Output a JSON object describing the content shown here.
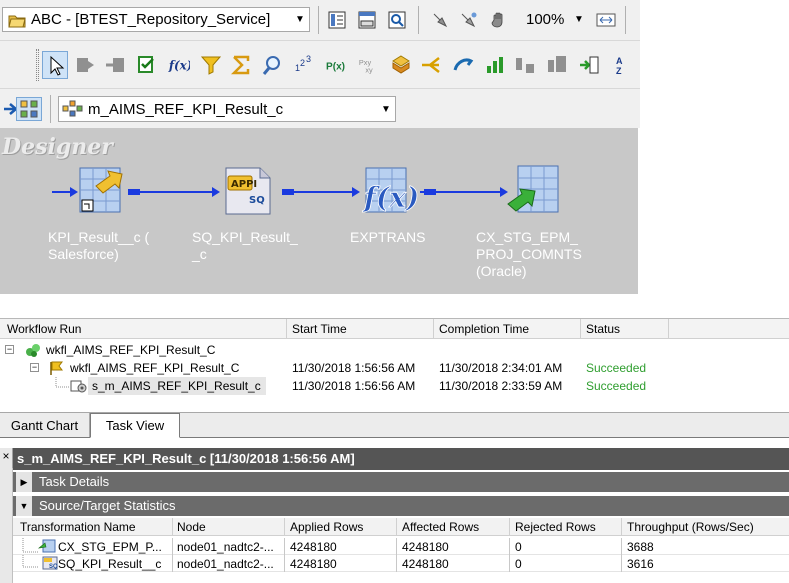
{
  "toolbar": {
    "repository": "ABC - [BTEST_Repository_Service]",
    "zoom": "100%",
    "mapping": "m_AIMS_REF_KPI_Result_c"
  },
  "designer": {
    "title": "Designer",
    "transformations": [
      {
        "label": "KPI_Result__c (\nSalesforce)"
      },
      {
        "label": "SQ_KPI_Result_\n_c"
      },
      {
        "label": "EXPTRANS"
      },
      {
        "label": "CX_STG_EPM_\nPROJ_COMNTS\n(Oracle)"
      }
    ]
  },
  "workflow_monitor": {
    "columns": [
      "Workflow Run",
      "Start Time",
      "Completion Time",
      "Status"
    ],
    "rows": [
      {
        "name": "wkfl_AIMS_REF_KPI_Result_C",
        "start": "",
        "completion": "",
        "status": ""
      },
      {
        "name": "wkfl_AIMS_REF_KPI_Result_C",
        "start": "11/30/2018 1:56:56 AM",
        "completion": "11/30/2018 2:34:01 AM",
        "status": "Succeeded"
      },
      {
        "name": "s_m_AIMS_REF_KPI_Result_c",
        "start": "11/30/2018 1:56:56 AM",
        "completion": "11/30/2018 2:33:59 AM",
        "status": "Succeeded"
      }
    ],
    "status_color": "#2f9e2f"
  },
  "tabs": [
    "Gantt Chart",
    "Task View"
  ],
  "session": {
    "close": "×",
    "title": "s_m_AIMS_REF_KPI_Result_c [11/30/2018 1:56:56 AM]",
    "sections": [
      "Task Details",
      "Source/Target Statistics"
    ],
    "stats_columns": [
      "Transformation Name",
      "Node",
      "Applied Rows",
      "Affected Rows",
      "Rejected Rows",
      "Throughput (Rows/Sec)"
    ],
    "stats_rows": [
      {
        "name": "CX_STG_EPM_P...",
        "node": "node01_nadtc2-...",
        "applied": "4248180",
        "affected": "4248180",
        "rejected": "0",
        "throughput": "3688"
      },
      {
        "name": "SQ_KPI_Result__c",
        "node": "node01_nadtc2-...",
        "applied": "4248180",
        "affected": "4248180",
        "rejected": "0",
        "throughput": "3616"
      }
    ]
  }
}
